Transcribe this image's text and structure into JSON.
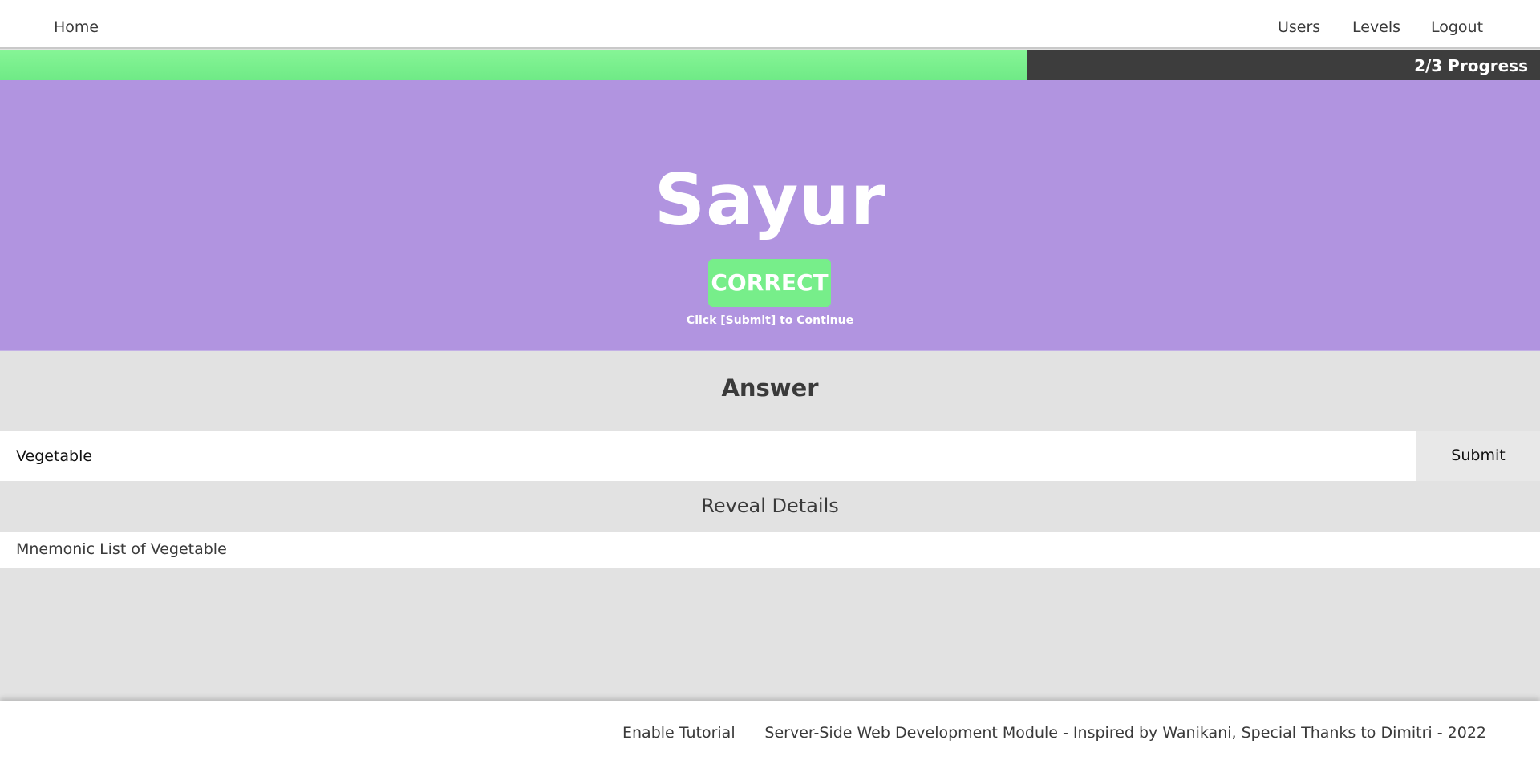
{
  "nav": {
    "home": "Home",
    "users": "Users",
    "levels": "Levels",
    "logout": "Logout"
  },
  "progress": {
    "label": "2/3 Progress",
    "fraction": 0.6667,
    "fill_color": "#77ee8a",
    "track_color": "#3d3d3d"
  },
  "hero": {
    "word": "Sayur",
    "status": "CORRECT",
    "hint": "Click [Submit] to Continue",
    "background_color": "#b194e0",
    "status_color": "#77ee8a"
  },
  "answer": {
    "heading": "Answer",
    "value": "Vegetable",
    "submit_label": "Submit"
  },
  "reveal": {
    "label": "Reveal Details"
  },
  "mnemonic": {
    "text": "Mnemonic List of Vegetable"
  },
  "footer": {
    "tutorial_label": "Enable Tutorial",
    "credit": "Server-Side Web Development Module - Inspired by Wanikani, Special Thanks to Dimitri - 2022"
  }
}
